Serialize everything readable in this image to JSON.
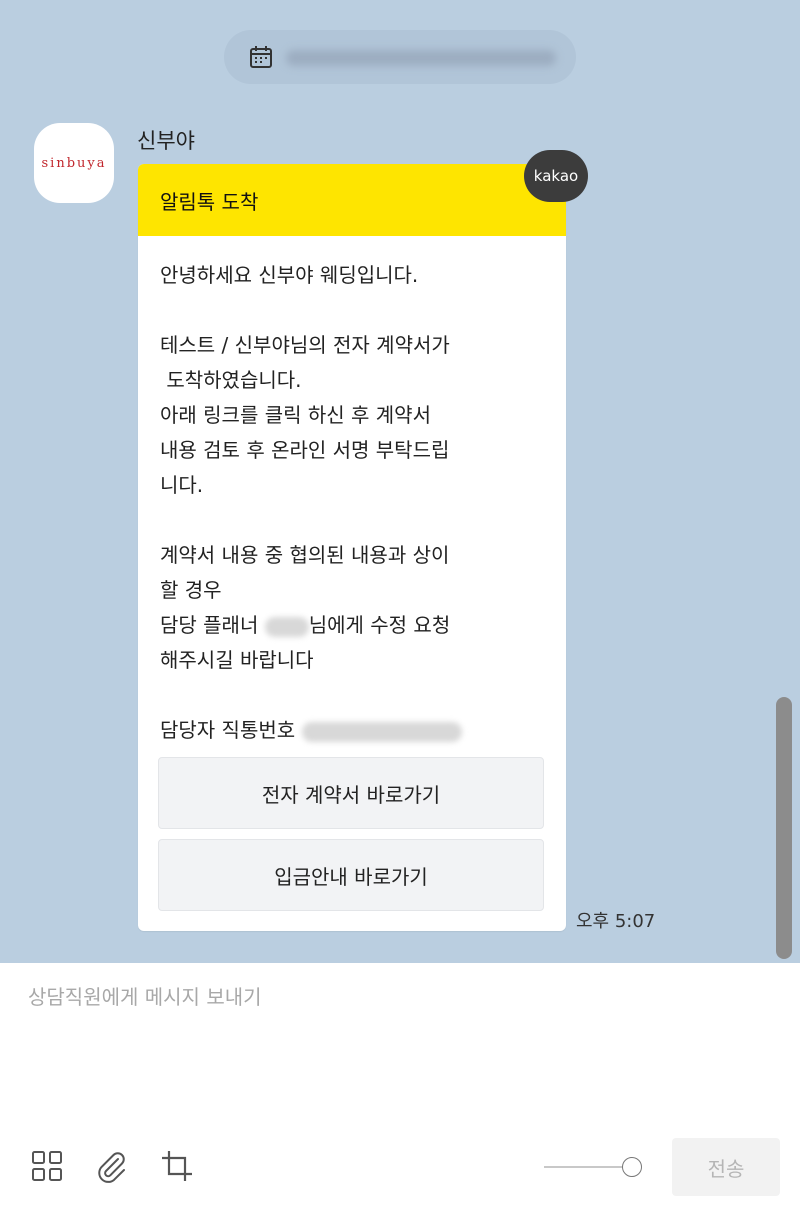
{
  "sender": {
    "name": "신부야",
    "avatar_text": "sinbuya"
  },
  "message": {
    "header": "알림톡 도착",
    "badge": "kakao",
    "lines": {
      "l1": "안녕하세요 신부야 웨딩입니다.",
      "l2": "테스트 / 신부야님의 전자 계약서가",
      "l3": " 도착하였습니다.",
      "l4": "아래 링크를 클릭 하신 후 계약서",
      "l5": "내용 검토 후 온라인 서명 부탁드립",
      "l6": "니다.",
      "l7": "계약서 내용 중 협의된 내용과 상이",
      "l8": "할 경우",
      "l9a": "담당 플래너 ",
      "l9b": "님에게 수정 요청",
      "l10": "해주시길 바랍니다",
      "l11": "담당자 직통번호 "
    },
    "buttons": {
      "contract": "전자 계약서 바로가기",
      "deposit": "입금안내 바로가기"
    },
    "time": "오후 5:07"
  },
  "composer": {
    "placeholder": "상담직원에게 메시지 보내기",
    "send_label": "전송"
  },
  "icons": {
    "calendar": "calendar-icon",
    "grid": "grid-icon",
    "attach": "paperclip-icon",
    "crop": "crop-icon"
  },
  "colors": {
    "chat_background": "#bacee0",
    "kakao_yellow": "#fee500",
    "badge_dark": "#3c3c3c",
    "brand_red": "#c1272d"
  }
}
